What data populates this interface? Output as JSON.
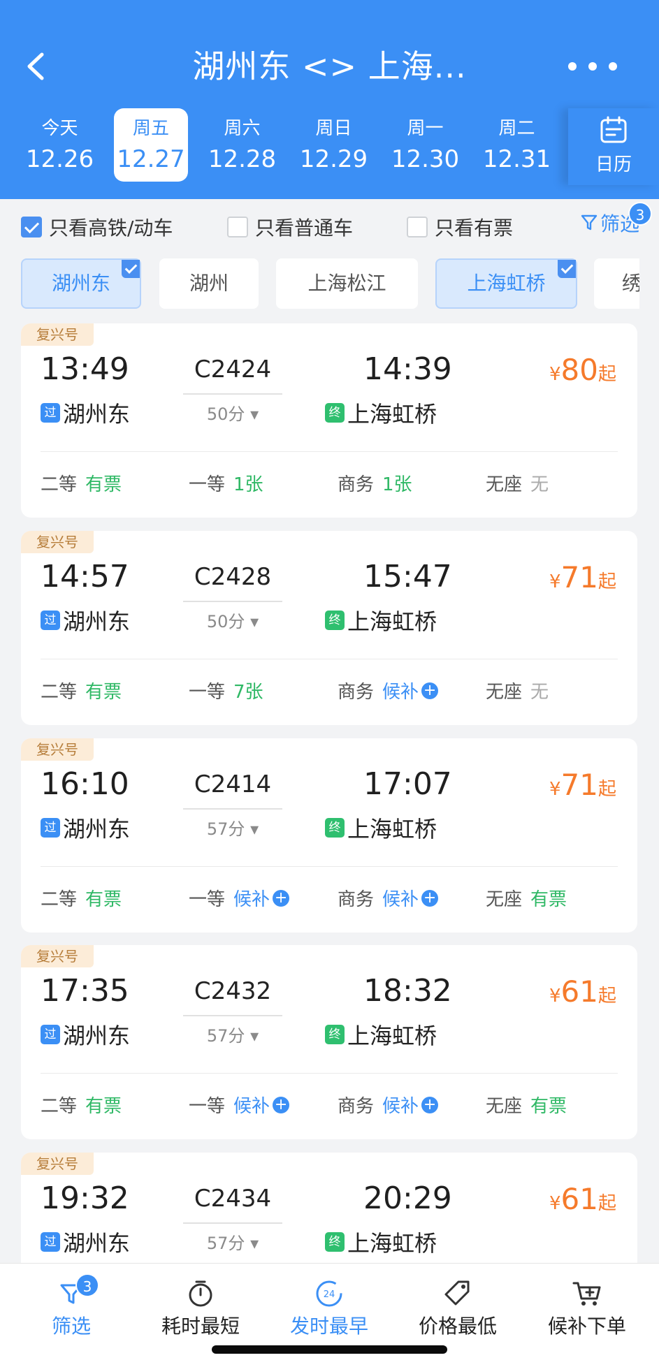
{
  "header": {
    "title": "湖州东 <> 上海...",
    "dates": [
      {
        "weekday": "今天",
        "date": "12.26"
      },
      {
        "weekday": "周五",
        "date": "12.27"
      },
      {
        "weekday": "周六",
        "date": "12.28"
      },
      {
        "weekday": "周日",
        "date": "12.29"
      },
      {
        "weekday": "周一",
        "date": "12.30"
      },
      {
        "weekday": "周二",
        "date": "12.31"
      }
    ],
    "selected_date_index": 1,
    "calendar_label": "日历"
  },
  "filters": {
    "high_speed": {
      "label": "只看高铁/动车",
      "checked": true
    },
    "normal": {
      "label": "只看普通车",
      "checked": false
    },
    "available": {
      "label": "只看有票",
      "checked": false
    },
    "screen_label": "筛选",
    "screen_count": "3"
  },
  "stations": [
    {
      "name": "湖州东",
      "selected": true
    },
    {
      "name": "湖州",
      "selected": false
    },
    {
      "name": "上海松江",
      "selected": false
    },
    {
      "name": "上海虹桥",
      "selected": true
    },
    {
      "name": "绣",
      "selected": false
    }
  ],
  "trains": [
    {
      "tag": "复兴号",
      "dep_time": "13:49",
      "train_no": "C2424",
      "duration": "50分",
      "arr_time": "14:39",
      "price": "80",
      "price_prefix": "¥",
      "price_suffix": "起",
      "from_icon": "过",
      "from": "湖州东",
      "to_icon": "终",
      "to": "上海虹桥",
      "seats": [
        {
          "label": "二等",
          "value": "有票",
          "status": "green"
        },
        {
          "label": "一等",
          "value": "1张",
          "status": "green"
        },
        {
          "label": "商务",
          "value": "1张",
          "status": "green"
        },
        {
          "label": "无座",
          "value": "无",
          "status": "none"
        }
      ]
    },
    {
      "tag": "复兴号",
      "dep_time": "14:57",
      "train_no": "C2428",
      "duration": "50分",
      "arr_time": "15:47",
      "price": "71",
      "price_prefix": "¥",
      "price_suffix": "起",
      "from_icon": "过",
      "from": "湖州东",
      "to_icon": "终",
      "to": "上海虹桥",
      "seats": [
        {
          "label": "二等",
          "value": "有票",
          "status": "green"
        },
        {
          "label": "一等",
          "value": "7张",
          "status": "green"
        },
        {
          "label": "商务",
          "value": "候补",
          "status": "blue"
        },
        {
          "label": "无座",
          "value": "无",
          "status": "none"
        }
      ]
    },
    {
      "tag": "复兴号",
      "dep_time": "16:10",
      "train_no": "C2414",
      "duration": "57分",
      "arr_time": "17:07",
      "price": "71",
      "price_prefix": "¥",
      "price_suffix": "起",
      "from_icon": "过",
      "from": "湖州东",
      "to_icon": "终",
      "to": "上海虹桥",
      "seats": [
        {
          "label": "二等",
          "value": "有票",
          "status": "green"
        },
        {
          "label": "一等",
          "value": "候补",
          "status": "blue"
        },
        {
          "label": "商务",
          "value": "候补",
          "status": "blue"
        },
        {
          "label": "无座",
          "value": "有票",
          "status": "green"
        }
      ]
    },
    {
      "tag": "复兴号",
      "dep_time": "17:35",
      "train_no": "C2432",
      "duration": "57分",
      "arr_time": "18:32",
      "price": "61",
      "price_prefix": "¥",
      "price_suffix": "起",
      "from_icon": "过",
      "from": "湖州东",
      "to_icon": "终",
      "to": "上海虹桥",
      "seats": [
        {
          "label": "二等",
          "value": "有票",
          "status": "green"
        },
        {
          "label": "一等",
          "value": "候补",
          "status": "blue"
        },
        {
          "label": "商务",
          "value": "候补",
          "status": "blue"
        },
        {
          "label": "无座",
          "value": "有票",
          "status": "green"
        }
      ]
    },
    {
      "tag": "复兴号",
      "dep_time": "19:32",
      "train_no": "C2434",
      "duration": "57分",
      "arr_time": "20:29",
      "price": "61",
      "price_prefix": "¥",
      "price_suffix": "起",
      "from_icon": "过",
      "from": "湖州东",
      "to_icon": "终",
      "to": "上海虹桥",
      "seats": []
    }
  ],
  "bottom_bar": {
    "tabs": [
      {
        "label": "筛选",
        "icon": "filter-icon",
        "badge": "3",
        "active": true
      },
      {
        "label": "耗时最短",
        "icon": "stopwatch-icon",
        "active": false
      },
      {
        "label": "发时最早",
        "icon": "clock-24-icon",
        "icon_text": "24",
        "active": true
      },
      {
        "label": "价格最低",
        "icon": "price-tag-icon",
        "active": false
      },
      {
        "label": "候补下单",
        "icon": "cart-plus-icon",
        "active": false
      }
    ]
  },
  "colors": {
    "brand_blue": "#3b8ff5",
    "price_orange": "#f57a2b",
    "available_green": "#2fb865",
    "fuxing_tag_bg": "#fcecd8"
  }
}
